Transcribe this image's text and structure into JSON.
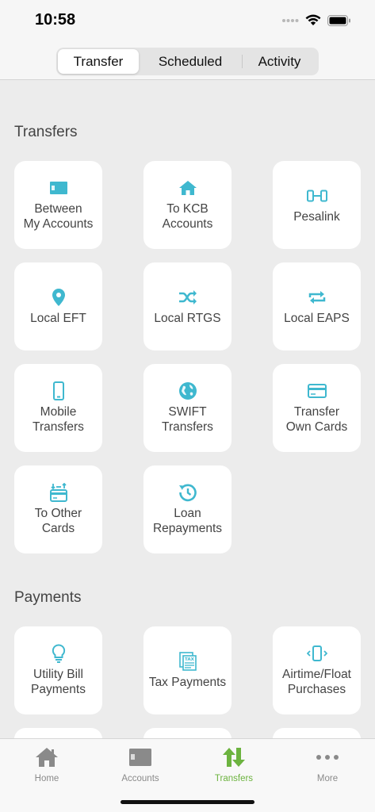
{
  "status_bar": {
    "time": "10:58"
  },
  "segmented": {
    "tabs": [
      {
        "label": "Transfer",
        "active": true
      },
      {
        "label": "Scheduled",
        "active": false
      },
      {
        "label": "Activity",
        "active": false
      }
    ]
  },
  "transfers": {
    "title": "Transfers",
    "items": [
      {
        "label": "Between\nMy Accounts",
        "icon": "wallet-icon"
      },
      {
        "label": "To KCB\nAccounts",
        "icon": "home-icon"
      },
      {
        "label": "Pesalink",
        "icon": "phone-link-icon"
      },
      {
        "label": "Local EFT",
        "icon": "location-pin-icon"
      },
      {
        "label": "Local RTGS",
        "icon": "shuffle-icon"
      },
      {
        "label": "Local EAPS",
        "icon": "repeat-icon"
      },
      {
        "label": "Mobile\nTransfers",
        "icon": "mobile-phone-icon"
      },
      {
        "label": "SWIFT\nTransfers",
        "icon": "globe-icon"
      },
      {
        "label": "Transfer\nOwn Cards",
        "icon": "credit-card-icon"
      },
      {
        "label": "To Other\nCards",
        "icon": "card-transfer-icon"
      },
      {
        "label": "Loan\nRepayments",
        "icon": "history-clock-icon"
      }
    ]
  },
  "payments": {
    "title": "Payments",
    "items": [
      {
        "label": "Utility Bill\nPayments",
        "icon": "lightbulb-icon"
      },
      {
        "label": "Tax Payments",
        "icon": "tax-document-icon"
      },
      {
        "label": "Airtime/Float\nPurchases",
        "icon": "phone-vibrate-icon"
      }
    ]
  },
  "tab_bar": {
    "items": [
      {
        "label": "Home",
        "icon": "home-icon",
        "active": false
      },
      {
        "label": "Accounts",
        "icon": "wallet-icon",
        "active": false
      },
      {
        "label": "Transfers",
        "icon": "transfer-arrows-icon",
        "active": true
      },
      {
        "label": "More",
        "icon": "more-dots-icon",
        "active": false
      }
    ]
  },
  "colors": {
    "accent": "#3fb8cf",
    "active_tab": "#6cb33f",
    "inactive_tab": "#8a8a8a"
  }
}
